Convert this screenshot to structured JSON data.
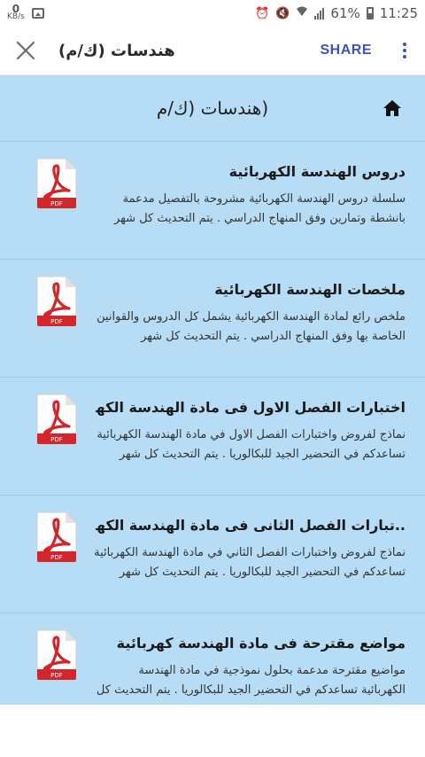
{
  "status_bar": {
    "speed_value": "0",
    "speed_unit": "KB/s",
    "battery_percent": "61%",
    "time": "11:25",
    "icons": [
      "image-icon",
      "alarm-icon",
      "mute-icon",
      "wifi-icon",
      "signal-icon",
      "battery-icon"
    ]
  },
  "app_bar": {
    "title": "هندسات (ك/م)",
    "share_label": "SHARE",
    "accent_color": "#3f51b5"
  },
  "page": {
    "header_title": "(هندسات (ك/م"
  },
  "items": [
    {
      "title": "دروس الهندسة الكهربائية",
      "description": "سلسلة دروس الهندسة الكهربائية مشروحة بالتفصيل مدعمة بانشطة وتمارين وفق المنهاج الدراسي . يتم التحديث كل شهر",
      "icon": "pdf-icon"
    },
    {
      "title": "ملخصات الهندسة الكهربائية",
      "description": "ملخص رائع لمادة الهندسة الكهربائية يشمل كل الدروس والقوانين الخاصة بها وفق المنهاج الدراسي . يتم التحديث كل شهر",
      "icon": "pdf-icon"
    },
    {
      "title": "اختبارات الفصل الاول فى مادة الهندسة الكهربائية",
      "description": "نماذج لفروض واختبارات الفصل الاول في مادة الهندسة الكهربائية تساعدكم في التحضير الجيد للبكالوريا . يتم التحديث كل شهر",
      "icon": "pdf-icon"
    },
    {
      "title": "..تبارات الفصل الثانى فى مادة الهندسة الكهربائية",
      "description": "نماذج لفروض واختبارات الفصل الثاني في مادة الهندسة الكهربائية تساعدكم في التحضير الجيد للبكالوريا . يتم التحديث كل شهر",
      "icon": "pdf-icon"
    },
    {
      "title": "مواضع مقترحة فى مادة الهندسة كهربائية",
      "description": "مواضيع مقترحة مدعمة بحلول نموذجية في مادة الهندسة الكهربائية تساعدكم في التحضير الجيد للبكالوريا . يتم التحديث كل شهر",
      "icon": "pdf-icon"
    }
  ],
  "colors": {
    "content_background": "#b6ddf5",
    "pdf_red": "#d0262c"
  }
}
